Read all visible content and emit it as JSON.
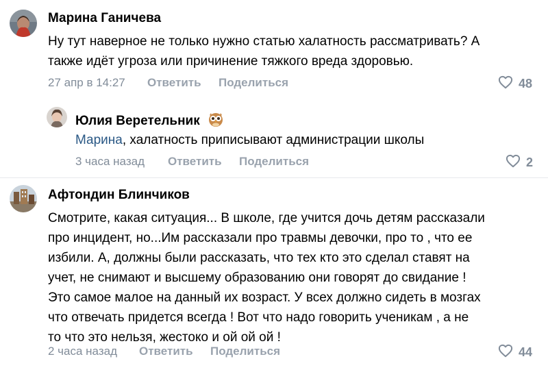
{
  "comments": [
    {
      "author": "Марина Ганичева",
      "lines": [
        "Ну тут наверное не только нужно статью халатность рассматривать? А",
        "также идёт угроза или причинение тяжкого вреда здоровью."
      ],
      "time": "27 апр в 14:27",
      "reply_label": "Ответить",
      "share_label": "Поделиться",
      "likes": "48"
    },
    {
      "author": "Юлия Веретельник",
      "mention": "Марина",
      "text_after_mention": ", халатность приписывают администрации школы",
      "time": "3 часа назад",
      "reply_label": "Ответить",
      "share_label": "Поделиться",
      "likes": "2"
    },
    {
      "author": "Афтондин Блинчиков",
      "lines": [
        "Смотрите, какая ситуация... В школе, где учится дочь детям рассказали",
        "про инцидент, но...Им рассказали про травмы девочки, про то , что ее",
        "избили. А, должны были рассказать, что тех кто это сделал ставят на",
        "учет, не снимают и высшему образованию они говорят до свидание !",
        "Это самое малое на данный их возраст. У всех должно сидеть в мозгах",
        "что отвечать придется всегда ! Вот что надо говорить ученикам , а не",
        "то что это нельзя, жестоко и ой ой ой !"
      ],
      "time": "2 часа назад",
      "reply_label": "Ответить",
      "share_label": "Поделиться",
      "likes": "44"
    }
  ],
  "colors": {
    "text": "#000000",
    "meta": "#818c99",
    "action": "#99a2ad",
    "mention": "#2a5885",
    "divider": "#e7e8ec"
  },
  "icons": [
    "heart-icon",
    "owl-emoji-icon"
  ]
}
